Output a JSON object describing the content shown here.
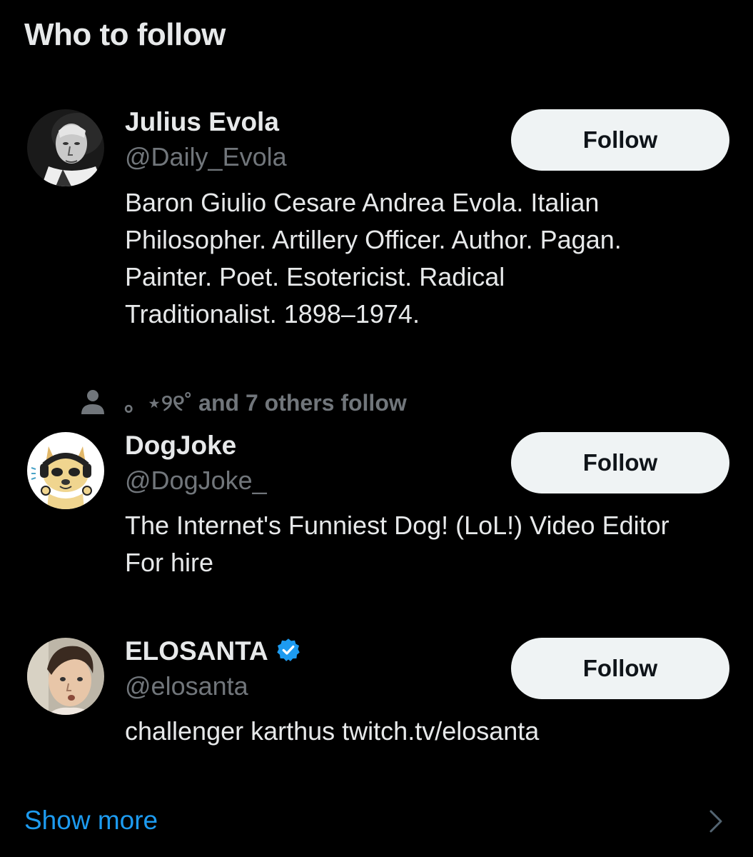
{
  "section_title": "Who to follow",
  "users": [
    {
      "name": "Julius Evola",
      "handle": "@Daily_Evola",
      "bio_lines": [
        "Baron Giulio Cesare Andrea Evola. Italian",
        "Philosopher. Artillery Officer. Author. Pagan.",
        "Painter. Poet. Esotericist. Radical",
        "Traditionalist. 1898–1974."
      ],
      "follow_label": "Follow",
      "avatar_icon": "portrait-photo"
    },
    {
      "social_context": "。⋆୨୧˚ and 7 others follow",
      "social_icon": "person-icon",
      "name": "DogJoke",
      "handle": "@DogJoke_",
      "bio_lines": [
        "The Internet's Funniest Dog! (LoL!) Video Editor",
        "For hire"
      ],
      "follow_label": "Follow",
      "avatar_icon": "cartoon-dog"
    },
    {
      "name": "ELOSANTA",
      "verified": true,
      "verified_icon": "verified-badge-icon",
      "handle": "@elosanta",
      "bio_lines": [
        "challenger karthus twitch.tv/elosanta"
      ],
      "follow_label": "Follow",
      "avatar_icon": "selfie-photo"
    }
  ],
  "show_more_label": "Show more",
  "colors": {
    "background": "#000000",
    "primary_text": "#e7e9ea",
    "secondary_text": "#71767b",
    "button_bg": "#eff3f4",
    "button_text": "#0f1419",
    "link": "#1d9bf0",
    "verified": "#1d9bf0"
  }
}
